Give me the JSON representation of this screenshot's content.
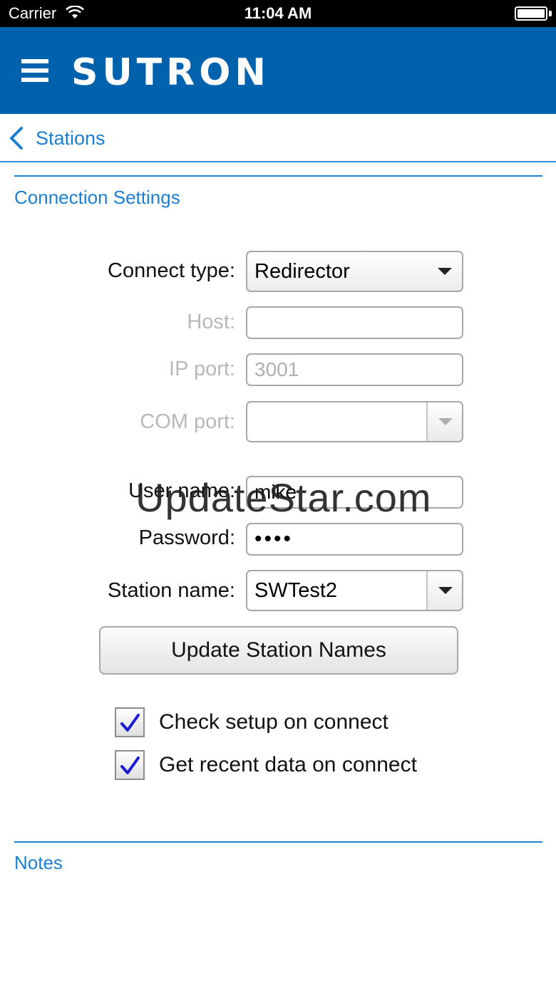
{
  "status_bar": {
    "carrier": "Carrier",
    "time": "11:04 AM"
  },
  "header": {
    "logo": "SUTRON",
    "bg_color": "#0062ad"
  },
  "nav": {
    "back_label": "Stations"
  },
  "sections": {
    "connection": "Connection Settings",
    "notes": "Notes"
  },
  "form": {
    "connect_type": {
      "label": "Connect type:",
      "value": "Redirector"
    },
    "host": {
      "label": "Host:",
      "value": ""
    },
    "ip_port": {
      "label": "IP port:",
      "value": "3001"
    },
    "com_port": {
      "label": "COM port:",
      "value": ""
    },
    "user_name": {
      "label": "User name:",
      "value": "mike"
    },
    "password": {
      "label": "Password:",
      "value": "••••"
    },
    "station_name": {
      "label": "Station name:",
      "value": "SWTest2"
    },
    "update_button": "Update Station Names",
    "check_setup": {
      "label": "Check setup on connect",
      "checked": true
    },
    "get_recent": {
      "label": "Get recent data on connect",
      "checked": true
    }
  },
  "watermark": "UpdateStar.com"
}
